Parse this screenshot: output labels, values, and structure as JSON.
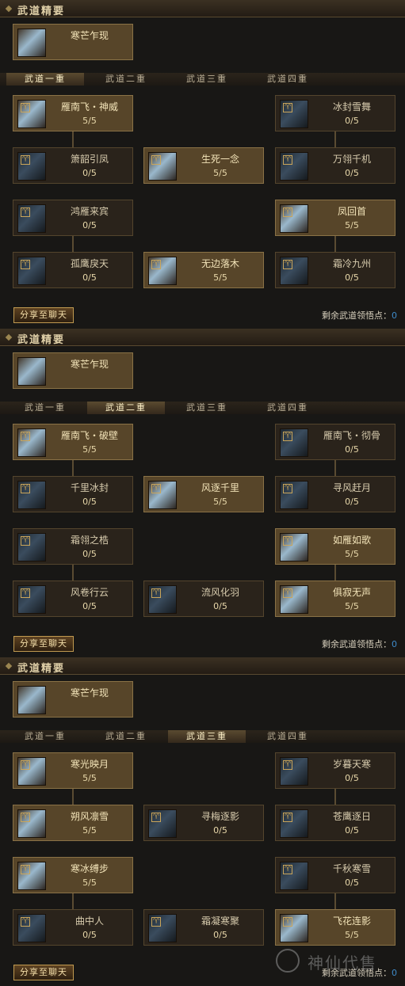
{
  "common": {
    "essence_title": "武道精要",
    "share_label": "分享至聊天",
    "points_label": "剩余武道领悟点：",
    "points_value": "0",
    "watermark": "神仙代售"
  },
  "tabs": [
    "武道一重",
    "武道二重",
    "武道三重",
    "武道四重"
  ],
  "panels": [
    {
      "active_tab": 0,
      "essence": {
        "name": "寒芒乍现"
      },
      "skills": [
        {
          "name": "雁南飞・神威",
          "level": "5/5",
          "lit": true
        },
        {
          "name": "冰封雪舞",
          "level": "0/5",
          "lit": false
        },
        {
          "name": "箫韶引凤",
          "level": "0/5",
          "lit": false
        },
        {
          "name": "生死一念",
          "level": "5/5",
          "lit": true
        },
        {
          "name": "万翎千机",
          "level": "0/5",
          "lit": false
        },
        {
          "name": "鸿雁来宾",
          "level": "0/5",
          "lit": false
        },
        {
          "name": "凤回首",
          "level": "5/5",
          "lit": true
        },
        {
          "name": "孤鹰戾天",
          "level": "0/5",
          "lit": false
        },
        {
          "name": "无边落木",
          "level": "5/5",
          "lit": true
        },
        {
          "name": "霜冷九州",
          "level": "0/5",
          "lit": false
        }
      ]
    },
    {
      "active_tab": 1,
      "essence": {
        "name": "寒芒乍现"
      },
      "skills": [
        {
          "name": "雁南飞・破壁",
          "level": "5/5",
          "lit": true
        },
        {
          "name": "雁南飞・彻骨",
          "level": "0/5",
          "lit": false
        },
        {
          "name": "千里冰封",
          "level": "0/5",
          "lit": false
        },
        {
          "name": "风逐千里",
          "level": "5/5",
          "lit": true
        },
        {
          "name": "寻风赶月",
          "level": "0/5",
          "lit": false
        },
        {
          "name": "霜翎之梏",
          "level": "0/5",
          "lit": false
        },
        {
          "name": "如雁如歌",
          "level": "5/5",
          "lit": true
        },
        {
          "name": "风卷行云",
          "level": "0/5",
          "lit": false
        },
        {
          "name": "流风化羽",
          "level": "0/5",
          "lit": false
        },
        {
          "name": "俱寂无声",
          "level": "5/5",
          "lit": true
        }
      ]
    },
    {
      "active_tab": 2,
      "essence": {
        "name": "寒芒乍现"
      },
      "skills": [
        {
          "name": "寒光映月",
          "level": "5/5",
          "lit": true
        },
        {
          "name": "岁暮天寒",
          "level": "0/5",
          "lit": false
        },
        {
          "name": "朔风凛雪",
          "level": "5/5",
          "lit": true
        },
        {
          "name": "寻梅逐影",
          "level": "0/5",
          "lit": false
        },
        {
          "name": "苍鹰逐日",
          "level": "0/5",
          "lit": false
        },
        {
          "name": "寒冰缚步",
          "level": "5/5",
          "lit": true
        },
        {
          "name": "千秋寒雪",
          "level": "0/5",
          "lit": false
        },
        {
          "name": "曲中人",
          "level": "0/5",
          "lit": false
        },
        {
          "name": "霜凝寒聚",
          "level": "0/5",
          "lit": false
        },
        {
          "name": "飞花连影",
          "level": "5/5",
          "lit": true
        }
      ]
    }
  ]
}
